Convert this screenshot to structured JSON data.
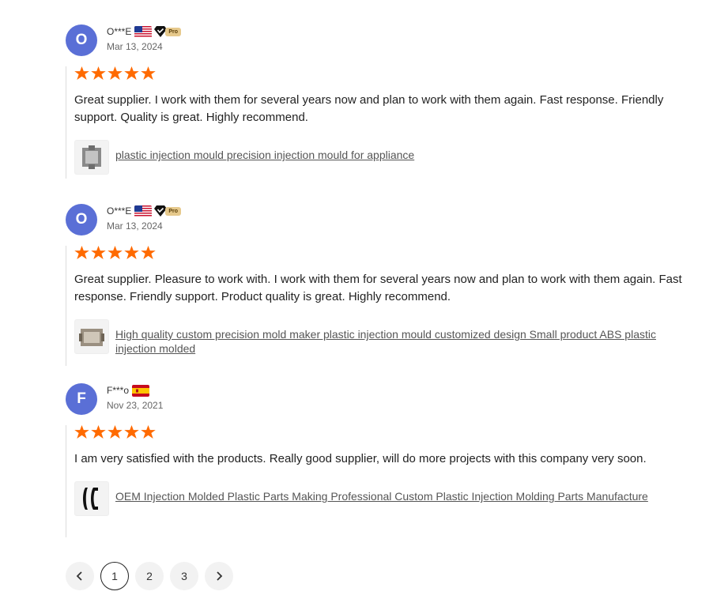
{
  "colors": {
    "star": "#ff6a00",
    "avatar": "#5a6fd6",
    "pro_badge": "#e6c98c"
  },
  "reviews": [
    {
      "avatar_letter": "O",
      "name": "O***E",
      "flag": "us-flag-icon",
      "pro_badge": "Pro",
      "date": "Mar 13, 2024",
      "rating": 5,
      "text": "Great supplier. I work with them for several years now and plan to work with them again. Fast response. Friendly support. Quality is great. Highly recommend.",
      "product": "plastic injection mould precision injection mould for appliance"
    },
    {
      "avatar_letter": "O",
      "name": "O***E",
      "flag": "us-flag-icon",
      "pro_badge": "Pro",
      "date": "Mar 13, 2024",
      "rating": 5,
      "text": "Great supplier. Pleasure to work with. I work with them for several years now and plan to work with them again. Fast response. Friendly support. Product quality is great. Highly recommend.",
      "product": "High quality custom precision mold maker plastic injection mould customized design Small product ABS plastic injection molded"
    },
    {
      "avatar_letter": "F",
      "name": "F***o",
      "flag": "spain-flag-icon",
      "date": "Nov 23, 2021",
      "rating": 5,
      "text": "I am very satisfied with the products. Really good supplier, will do more projects with this company very soon.",
      "product": "OEM Injection Molded Plastic Parts Making Professional Custom Plastic Injection Molding Parts Manufacture"
    }
  ],
  "pagination": {
    "prev_icon": "chevron-left-icon",
    "pages": [
      "1",
      "2",
      "3"
    ],
    "current": "1",
    "next_icon": "chevron-right-icon"
  }
}
